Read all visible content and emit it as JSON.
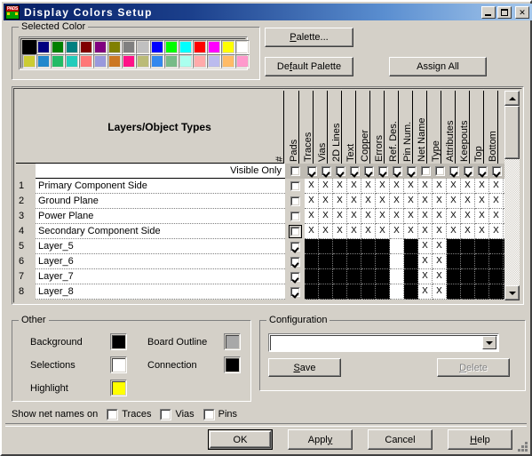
{
  "window": {
    "title": "Display Colors Setup",
    "icon": "pads-app-icon",
    "controls": [
      {
        "name": "minimize-button",
        "label": "_"
      },
      {
        "name": "maximize-button",
        "label": "□"
      },
      {
        "name": "close-button",
        "label": "✕"
      }
    ]
  },
  "selected_color": {
    "group_label": "Selected Color",
    "selected_index": 0,
    "row1": [
      "#000000",
      "#000080",
      "#008000",
      "#008080",
      "#800000",
      "#800080",
      "#808000",
      "#808080",
      "#c0c0c0",
      "#0000ff",
      "#00ff00",
      "#00ffff",
      "#ff0000",
      "#ff00ff",
      "#ffff00",
      "#ffffff"
    ],
    "row2": [
      "#cccc33",
      "#2288cc",
      "#22bb66",
      "#22ccbb",
      "#ff7777",
      "#9999dd",
      "#cc7722",
      "#ff1188",
      "#bbbb77",
      "#3388ee",
      "#77bb88",
      "#aaffee",
      "#ffaaaa",
      "#bbbbee",
      "#ffbb66",
      "#ff99cc"
    ]
  },
  "buttons": {
    "palette": {
      "pre": "",
      "accel": "P",
      "post": "alette..."
    },
    "default_palette": {
      "pre": "De",
      "accel": "f",
      "post": "ault Palette"
    },
    "assign_all": {
      "pre": "Assign All",
      "accel": "",
      "post": ""
    },
    "save": {
      "pre": "",
      "accel": "S",
      "post": "ave"
    },
    "delete": {
      "pre": "",
      "accel": "D",
      "post": "elete",
      "disabled": true
    },
    "ok": {
      "pre": "OK",
      "accel": "",
      "post": "",
      "default": true
    },
    "apply": {
      "pre": "Appl",
      "accel": "y",
      "post": ""
    },
    "cancel": {
      "pre": "Cancel",
      "accel": "",
      "post": ""
    },
    "help": {
      "pre": "",
      "accel": "H",
      "post": "elp"
    }
  },
  "grid": {
    "title": "Layers/Object Types",
    "columns": [
      "#",
      "Pads",
      "Traces",
      "Vias",
      "2D Lines",
      "Text",
      "Copper",
      "Errors",
      "Ref. Des.",
      "Pin Num.",
      "Net Name",
      "Type",
      "Attributes",
      "Keepouts",
      "Top",
      "Bottom"
    ],
    "visible_only_label": "Visible Only",
    "visible_only": [
      false,
      true,
      true,
      true,
      true,
      true,
      true,
      true,
      true,
      false,
      false,
      true,
      true,
      true,
      true,
      true
    ],
    "rows": [
      {
        "num": "1",
        "name": "Primary Component Side",
        "checked": false,
        "focus": false,
        "cells": [
          "x",
          "x",
          "x",
          "x",
          "x",
          "x",
          "x",
          "x",
          "x",
          "x",
          "x",
          "x",
          "x",
          "x",
          "x"
        ]
      },
      {
        "num": "2",
        "name": "Ground Plane",
        "checked": false,
        "focus": false,
        "cells": [
          "x",
          "x",
          "x",
          "x",
          "x",
          "x",
          "x",
          "x",
          "x",
          "x",
          "x",
          "x",
          "x",
          "x",
          "x"
        ]
      },
      {
        "num": "3",
        "name": "Power Plane",
        "checked": false,
        "focus": false,
        "cells": [
          "x",
          "x",
          "x",
          "x",
          "x",
          "x",
          "x",
          "x",
          "x",
          "x",
          "x",
          "x",
          "x",
          "x",
          "x"
        ]
      },
      {
        "num": "4",
        "name": "Secondary Component Side",
        "checked": false,
        "focus": true,
        "cells": [
          "x",
          "x",
          "x",
          "x",
          "x",
          "x",
          "x",
          "x",
          "x",
          "x",
          "x",
          "x",
          "x",
          "x",
          "x"
        ]
      },
      {
        "num": "5",
        "name": "Layer_5",
        "checked": true,
        "focus": false,
        "cells": [
          "k",
          "k",
          "k",
          "k",
          "k",
          "k",
          "",
          "k",
          "x",
          "x",
          "k",
          "k",
          "k",
          "k",
          "k"
        ]
      },
      {
        "num": "6",
        "name": "Layer_6",
        "checked": true,
        "focus": false,
        "cells": [
          "k",
          "k",
          "k",
          "k",
          "k",
          "k",
          "",
          "k",
          "x",
          "x",
          "k",
          "k",
          "k",
          "k",
          "k"
        ]
      },
      {
        "num": "7",
        "name": "Layer_7",
        "checked": true,
        "focus": false,
        "cells": [
          "k",
          "k",
          "k",
          "k",
          "k",
          "k",
          "",
          "k",
          "x",
          "x",
          "k",
          "k",
          "k",
          "k",
          "k"
        ]
      },
      {
        "num": "8",
        "name": "Layer_8",
        "checked": true,
        "focus": false,
        "cells": [
          "k",
          "k",
          "k",
          "k",
          "k",
          "k",
          "",
          "k",
          "x",
          "x",
          "k",
          "k",
          "k",
          "k",
          "k"
        ]
      }
    ],
    "scrollbar": {
      "up": "scroll-up-arrow",
      "down": "scroll-down-arrow"
    }
  },
  "other": {
    "group_label": "Other",
    "items": [
      {
        "label": "Background",
        "color": "#000000"
      },
      {
        "label": "Selections",
        "color": "#ffffff"
      },
      {
        "label": "Highlight",
        "color": "#ffff00"
      },
      {
        "label": "Board Outline",
        "color": "#a8a8a8"
      },
      {
        "label": "Connection",
        "color": "#000000"
      }
    ]
  },
  "net_names": {
    "label": "Show net names on",
    "options": [
      {
        "label": "Traces",
        "checked": false
      },
      {
        "label": "Vias",
        "checked": false
      },
      {
        "label": "Pins",
        "checked": false
      }
    ]
  },
  "configuration": {
    "group_label": "Configuration",
    "value": "",
    "placeholder": ""
  }
}
